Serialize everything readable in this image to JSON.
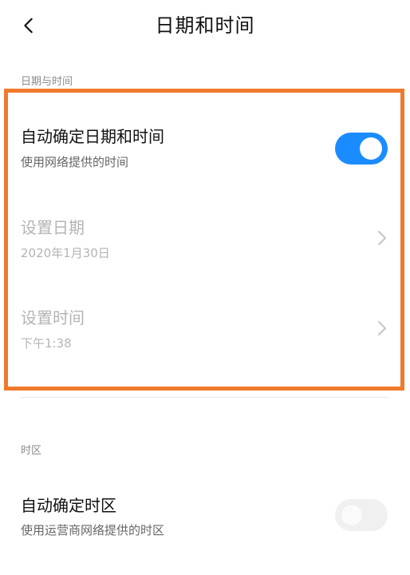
{
  "header": {
    "title": "日期和时间",
    "back_icon": "chevron-left-icon"
  },
  "sections": [
    {
      "label": "日期与时间",
      "rows": [
        {
          "title": "自动确定日期和时间",
          "subtitle": "使用网络提供的时间",
          "control": "toggle",
          "toggle_on": true
        },
        {
          "title": "设置日期",
          "subtitle": "2020年1月30日",
          "control": "chevron",
          "disabled": true
        },
        {
          "title": "设置时间",
          "subtitle": "下午1:38",
          "control": "chevron",
          "disabled": true
        }
      ]
    },
    {
      "label": "时区",
      "rows": [
        {
          "title": "自动确定时区",
          "subtitle": "使用运营商网络提供的时区",
          "control": "toggle",
          "toggle_on": false
        }
      ]
    }
  ],
  "colors": {
    "accent": "#1a8cff",
    "highlight_border": "#f07a2c",
    "disabled_text": "#b4b4b4",
    "section_label": "#8a8a8a"
  }
}
